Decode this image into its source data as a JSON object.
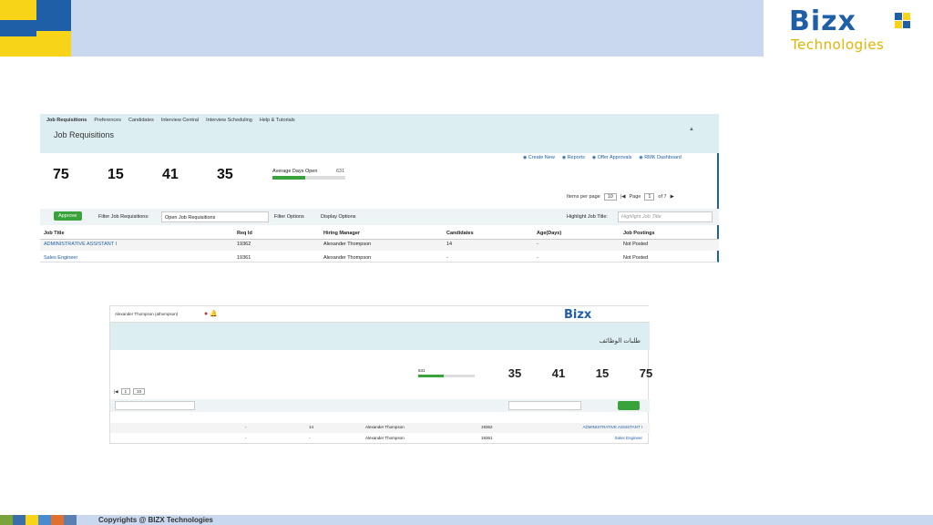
{
  "slide": {
    "footer_text": "Copyrights @ BIZX Technologies",
    "logo": {
      "word": "Bizx",
      "sub": "Technologies"
    }
  },
  "shot1": {
    "nav": [
      "Job Requisitions",
      "Preferences",
      "Candidates",
      "Interview Central",
      "Interview Scheduling",
      "Help & Tutorials"
    ],
    "page_title": "Job Requisitions",
    "actions": [
      "Create New",
      "Reports",
      "Offer Approvals",
      "RMK Dashboard"
    ],
    "kpis": [
      "75",
      "15",
      "41",
      "35"
    ],
    "avg": {
      "label": "Average Days Open",
      "value": "631",
      "fill_fraction": 0.45
    },
    "pager": {
      "items_label": "Items per page",
      "items_value": "10",
      "page_label": "Page",
      "page_value": "1",
      "of_label": "of 7"
    },
    "filter": {
      "approve": "Approve",
      "label": "Filter Job Requisitions:",
      "select": "Open Job Requisitions",
      "filter_options": "Filter Options",
      "display_options": "Display Options",
      "highlight_label": "Highlight Job Title:",
      "highlight_placeholder": "Highlight Job Title"
    },
    "columns": [
      "Job Title",
      "Req Id",
      "Hiring Manager",
      "Candidates",
      "Age(Days)",
      "Job Postings"
    ],
    "rows": [
      [
        "ADMINISTRATIVE ASSISTANT I",
        "19362",
        "Alexander Thompson",
        "14",
        "-",
        "Not Posted"
      ],
      [
        "Sales Engineer",
        "19361",
        "Alexander Thompson",
        "-",
        "-",
        "Not Posted"
      ]
    ]
  },
  "shot2": {
    "user": "Alexander Thompson (athompson)",
    "logo_word": "Bizx",
    "title": "طلبات الوظائف",
    "kpis": [
      "75",
      "15",
      "41",
      "35"
    ],
    "avg_value": "631",
    "avg_fill": 0.45,
    "pager_page": "1",
    "pager_items": "10",
    "rows": [
      [
        "ADMINISTRATIVE ASSISTANT I",
        "19362",
        "Alexander Thompson",
        "14",
        "-"
      ],
      [
        "Sales Engineer",
        "19361",
        "Alexander Thompson",
        "-",
        "-"
      ]
    ]
  }
}
